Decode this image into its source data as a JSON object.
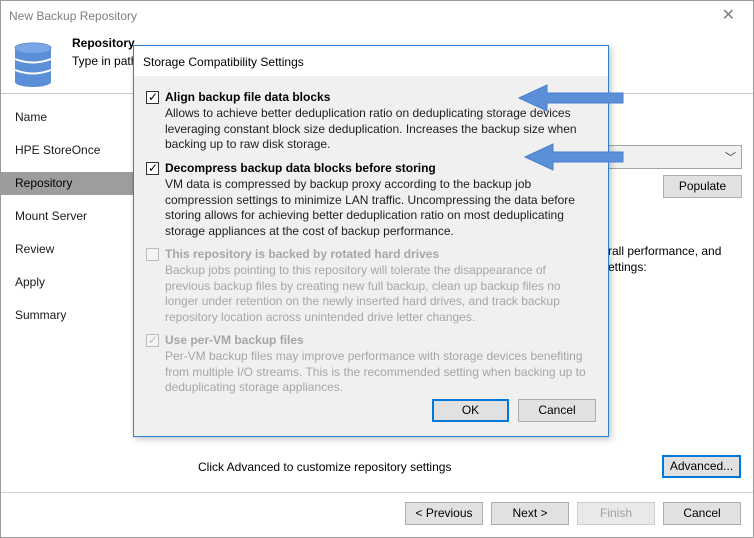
{
  "window": {
    "title": "New Backup Repository",
    "close_glyph": "✕"
  },
  "header": {
    "title": "Repository",
    "subtitle": "Type in path"
  },
  "nav": {
    "items": [
      {
        "label": "Name",
        "active": false
      },
      {
        "label": "HPE StoreOnce",
        "active": false
      },
      {
        "label": "Repository",
        "active": true
      },
      {
        "label": "Mount Server",
        "active": false
      },
      {
        "label": "Review",
        "active": false
      },
      {
        "label": "Apply",
        "active": false
      },
      {
        "label": "Summary",
        "active": false
      }
    ]
  },
  "content": {
    "populate_label": "Populate",
    "perf_text_line1": "rall performance, and",
    "perf_text_line2": "ettings:",
    "advanced_hint": "Click Advanced to customize repository settings",
    "advanced_label": "Advanced..."
  },
  "footer": {
    "previous_label": "< Previous",
    "next_label": "Next >",
    "finish_label": "Finish",
    "cancel_label": "Cancel"
  },
  "dialog": {
    "title": "Storage Compatibility Settings",
    "options": [
      {
        "title": "Align backup file data blocks",
        "checked": true,
        "enabled": true,
        "desc_lines": [
          "Allows to achieve better deduplication ratio on deduplicating storage devices",
          "leveraging constant block size deduplication. Increases the backup size when",
          "backing up to raw disk storage."
        ]
      },
      {
        "title": "Decompress backup data blocks before storing",
        "checked": true,
        "enabled": true,
        "desc_lines": [
          "VM data is compressed by backup proxy according to the backup job",
          "compression settings to minimize LAN traffic. Uncompressing the data before",
          "storing allows for achieving better deduplication ratio on most deduplicating",
          "storage appliances at the cost of backup performance."
        ]
      },
      {
        "title": "This repository is backed by rotated hard drives",
        "checked": false,
        "enabled": false,
        "desc_lines": [
          "Backup jobs pointing to this repository will tolerate the disappearance of",
          "previous backup files by creating new full backup, clean up backup files no",
          "longer under retention on the newly inserted hard drives, and track backup",
          "repository location across unintended drive letter changes."
        ]
      },
      {
        "title": "Use per-VM backup files",
        "checked": true,
        "enabled": false,
        "desc_lines": [
          "Per-VM backup files may improve performance with storage devices benefiting",
          "from multiple I/O streams. This is the recommended setting when backing up to",
          "deduplicating storage appliances."
        ]
      }
    ],
    "ok_label": "OK",
    "cancel_label": "Cancel"
  },
  "icons": {
    "check": "✓",
    "chevron": "﹀"
  },
  "colors": {
    "nav_active": "#9d9d9d",
    "dialog_border": "#2f7fd0",
    "arrow": "#5b8fd8"
  }
}
